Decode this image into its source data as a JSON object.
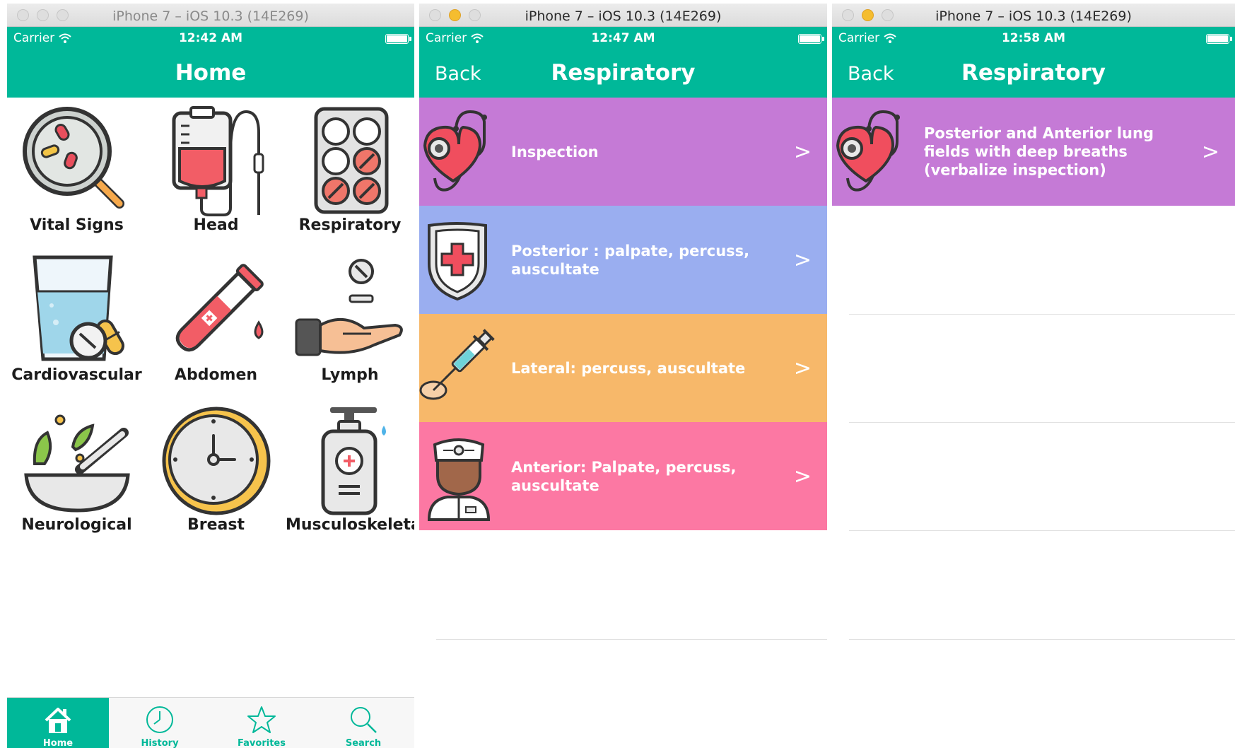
{
  "windows": [
    {
      "window_title": "iPhone 7 – iOS 10.3 (14E269)",
      "carrier": "Carrier",
      "time": "12:42 AM",
      "nav_title": "Home",
      "grid": [
        {
          "label": "Vital Signs",
          "icon": "magnifier-icon"
        },
        {
          "label": "Head",
          "icon": "iv-bag-icon"
        },
        {
          "label": "Respiratory",
          "icon": "pill-pack-icon"
        },
        {
          "label": "Cardiovascular",
          "icon": "water-glass-icon"
        },
        {
          "label": "Abdomen",
          "icon": "test-tube-icon"
        },
        {
          "label": "Lymph",
          "icon": "hand-pill-icon"
        },
        {
          "label": "Neurological",
          "icon": "mortar-pestle-icon"
        },
        {
          "label": "Breast",
          "icon": "clock-icon"
        },
        {
          "label": "Musculoskeletal",
          "icon": "dispenser-bottle-icon"
        }
      ],
      "tabs": [
        {
          "label": "Home",
          "icon": "home-icon",
          "active": true
        },
        {
          "label": "History",
          "icon": "clock-icon",
          "active": false
        },
        {
          "label": "Favorites",
          "icon": "star-icon",
          "active": false
        },
        {
          "label": "Search",
          "icon": "search-icon",
          "active": false
        }
      ]
    },
    {
      "window_title": "iPhone 7 – iOS 10.3 (14E269)",
      "carrier": "Carrier",
      "time": "12:47 AM",
      "back_label": "Back",
      "nav_title": "Respiratory",
      "rows": [
        {
          "text": "Inspection",
          "color": "#c57ad6",
          "icon": "heart-stethoscope-icon"
        },
        {
          "text": "Posterior : palpate, percuss, auscultate",
          "color": "#9aaef0",
          "icon": "shield-cross-icon"
        },
        {
          "text": "Lateral: percuss, auscultate",
          "color": "#f7b86a",
          "icon": "syringe-icon"
        },
        {
          "text": "Anterior: Palpate, percuss, auscultate",
          "color": "#fc78a3",
          "icon": "doctor-icon"
        }
      ],
      "chevron": ">"
    },
    {
      "window_title": "iPhone 7 – iOS 10.3 (14E269)",
      "carrier": "Carrier",
      "time": "12:58 AM",
      "back_label": "Back",
      "nav_title": "Respiratory",
      "rows": [
        {
          "text": "Posterior and Anterior lung fields with deep breaths (verbalize inspection)",
          "color": "#c57ad6",
          "icon": "heart-stethoscope-icon"
        }
      ],
      "chevron": ">"
    }
  ]
}
